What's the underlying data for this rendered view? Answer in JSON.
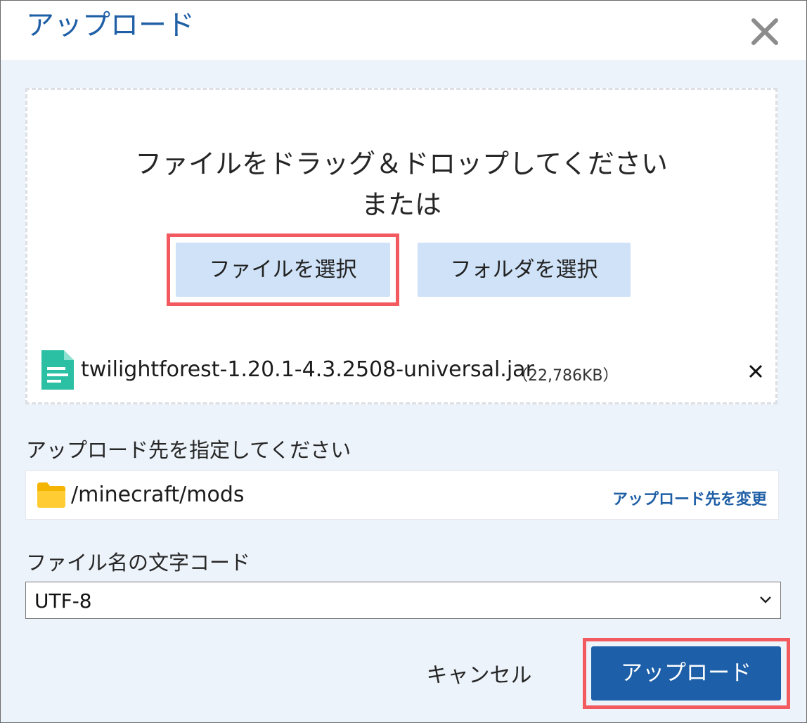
{
  "dialog": {
    "title": "アップロード"
  },
  "dropzone": {
    "instruction": "ファイルをドラッグ＆ドロップしてください",
    "or_text": "または",
    "select_file_label": "ファイルを選択",
    "select_folder_label": "フォルダを選択"
  },
  "file": {
    "name": "twilightforest-1.20.1-4.3.2508-universal.jar",
    "size": "（22,786KB）",
    "icon": "document-icon"
  },
  "destination": {
    "label": "アップロード先を指定してください",
    "path": "/minecraft/mods",
    "change_label": "アップロード先を変更",
    "icon": "folder-icon"
  },
  "encoding": {
    "label": "ファイル名の文字コード",
    "selected": "UTF-8"
  },
  "footer": {
    "cancel_label": "キャンセル",
    "upload_label": "アップロード"
  },
  "colors": {
    "accent": "#1d5fa8",
    "highlight": "#f25a5f",
    "light_button": "#cfe2f7",
    "panel_bg": "#edf3fb"
  }
}
